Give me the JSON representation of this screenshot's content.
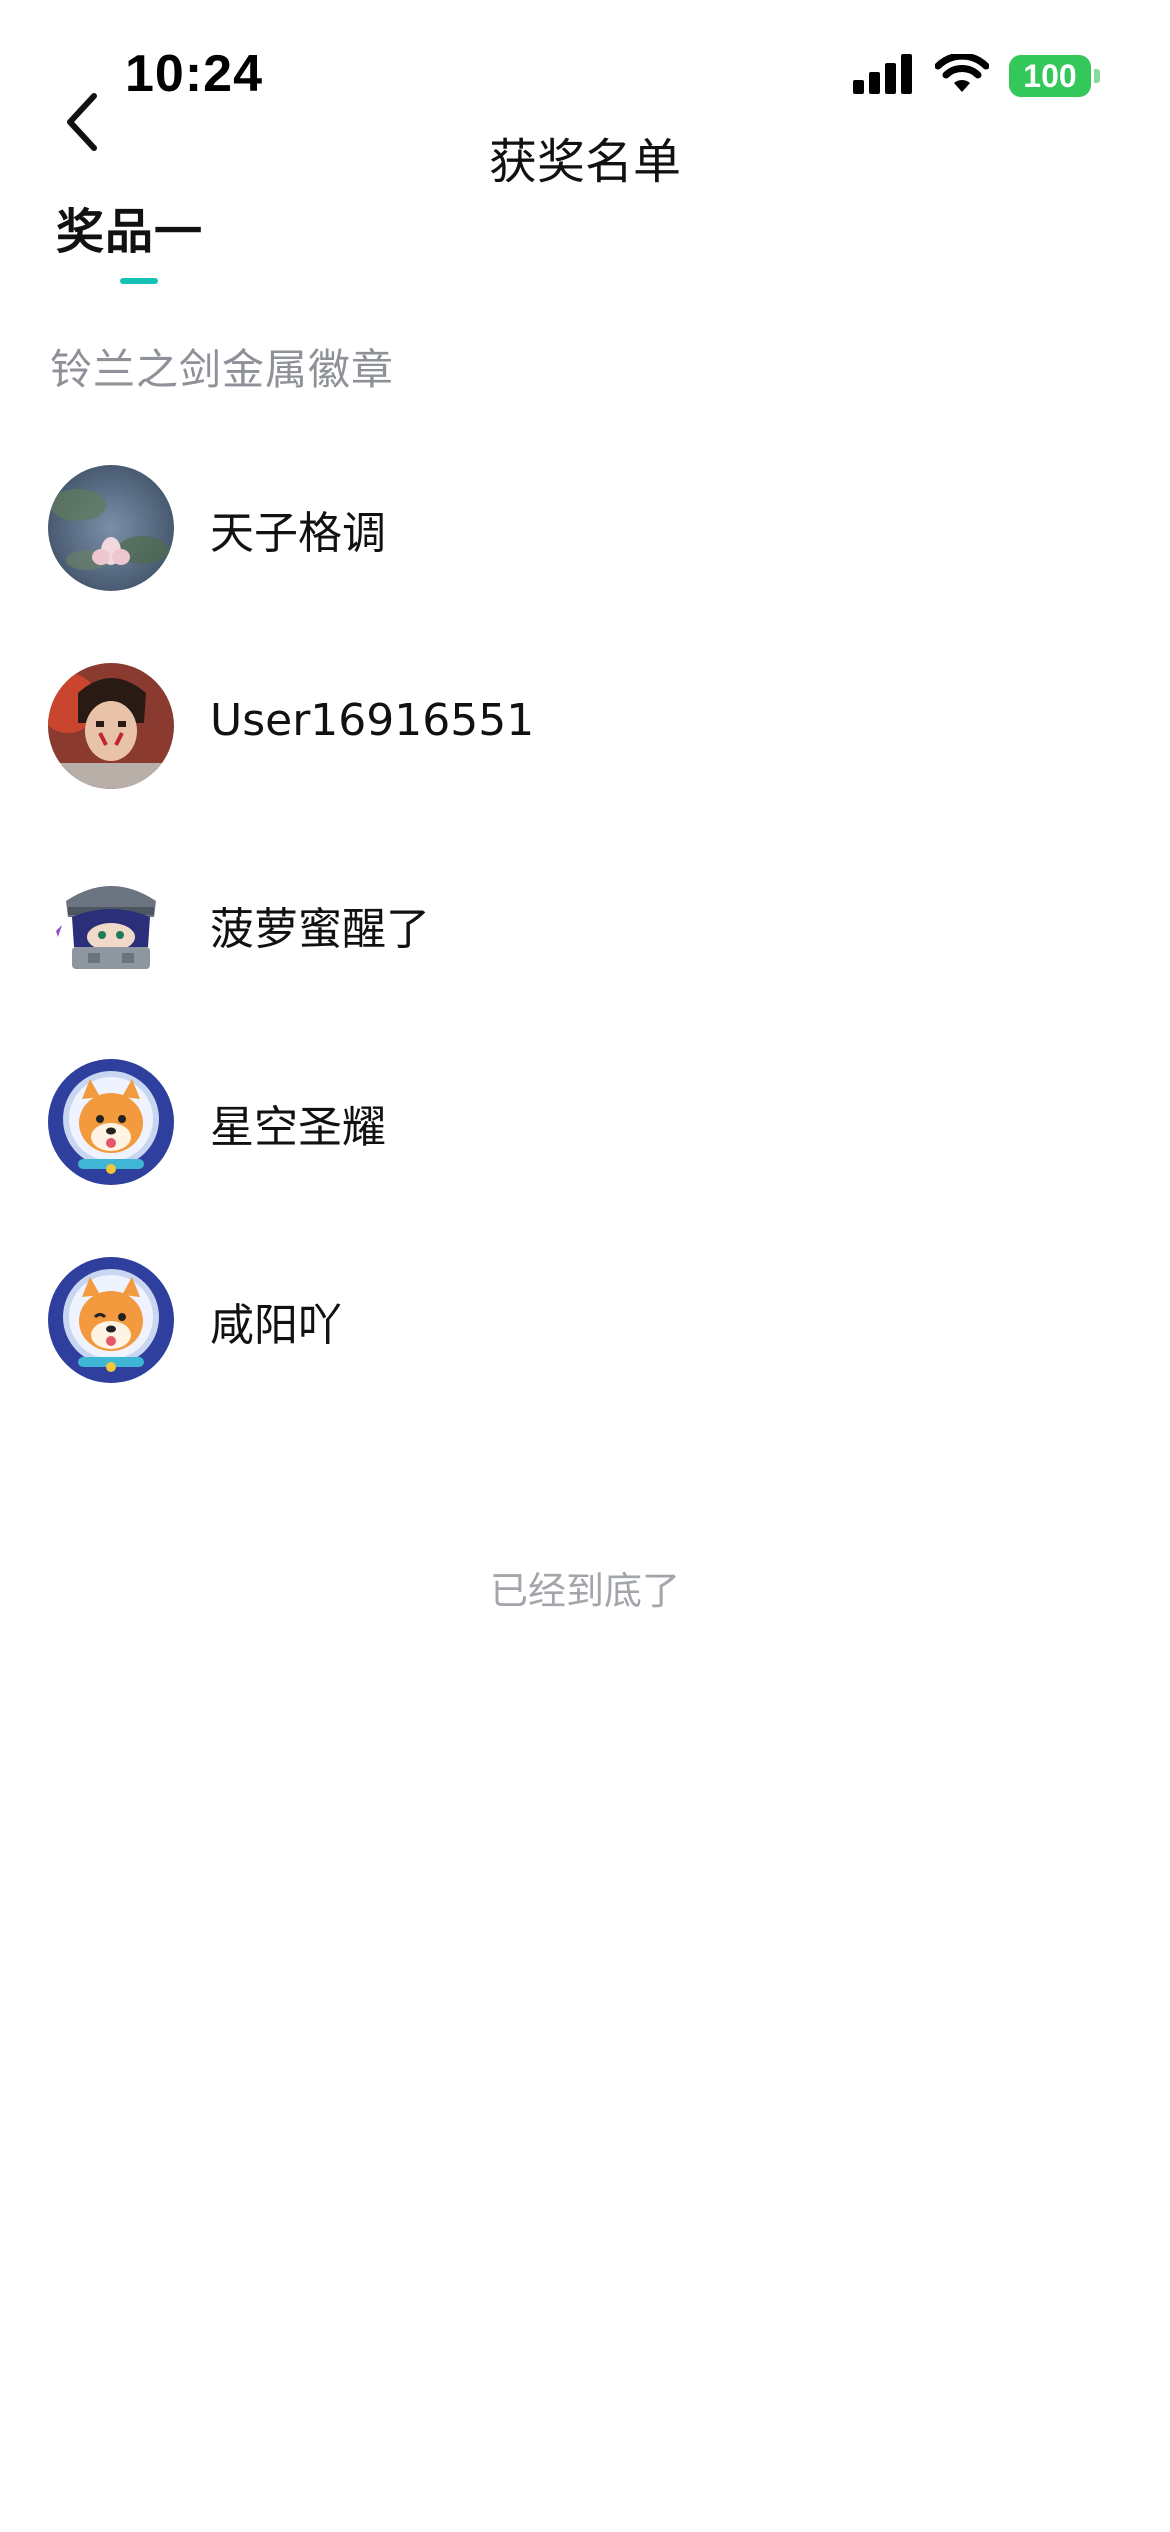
{
  "status_bar": {
    "time": "10:24",
    "battery": "100"
  },
  "nav": {
    "title": "获奖名单"
  },
  "tabs": [
    {
      "label": "奖品一",
      "active": true
    }
  ],
  "prize": {
    "name": "铃兰之剑金属徽章"
  },
  "winners": [
    {
      "name": "天子格调",
      "avatar": "lotus-avatar"
    },
    {
      "name": "User16916551",
      "avatar": "anime-warrior-avatar"
    },
    {
      "name": "菠萝蜜醒了",
      "avatar": "chibi-character-avatar"
    },
    {
      "name": "星空圣耀",
      "avatar": "shiba-astronaut-avatar"
    },
    {
      "name": "咸阳吖",
      "avatar": "shiba-astronaut-avatar"
    }
  ],
  "footer": {
    "end_text": "已经到底了"
  },
  "colors": {
    "accent": "#16c2b5",
    "battery": "#34c759",
    "secondary_text": "#8e9197"
  }
}
